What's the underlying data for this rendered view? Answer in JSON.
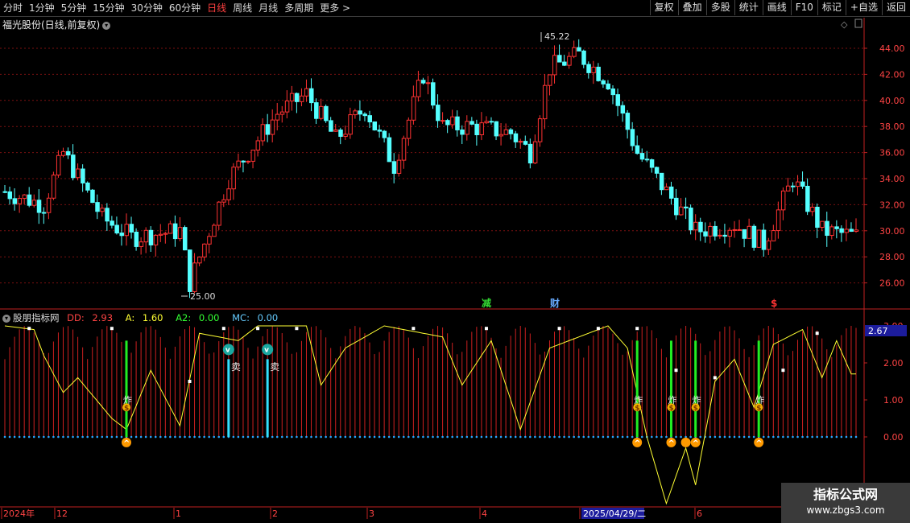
{
  "toolbar": {
    "periods": [
      "分时",
      "1分钟",
      "5分钟",
      "15分钟",
      "30分钟",
      "60分钟",
      "日线",
      "周线",
      "月线",
      "多周期",
      "更多 >"
    ],
    "active_period": "日线",
    "right_buttons": [
      "复权",
      "叠加",
      "多股",
      "统计",
      "画线",
      "F10",
      "标记",
      "+自选",
      "返回"
    ]
  },
  "main_panel": {
    "title": "福光股份(日线,前复权)",
    "high_label": "45.22",
    "low_label": "25.00",
    "price_ticks": [
      "44.00",
      "42.00",
      "40.00",
      "38.00",
      "36.00",
      "34.00",
      "32.00",
      "30.00",
      "28.00",
      "26.00"
    ],
    "markers": [
      {
        "text": "减",
        "color": "#33dd33"
      },
      {
        "text": "财",
        "color": "#66aaff"
      },
      {
        "text": "$",
        "color": "#ff3333"
      }
    ]
  },
  "indicator": {
    "name": "股朋指标网",
    "dd_label": "DD:",
    "dd_value": "2.93",
    "a_label": "A:",
    "a_value": "1.60",
    "a2_label": "A2:",
    "a2_value": "0.00",
    "mc_label": "MC:",
    "mc_value": "0.00",
    "axis_ticks": [
      "2.00",
      "1.00",
      "0.00"
    ],
    "current_value": "2.67",
    "sell_label": "卖",
    "zha_label": "炸"
  },
  "time_axis": {
    "labels": [
      "2024年",
      "12",
      "1",
      "2",
      "3",
      "4",
      "2025/04/29/二",
      "6"
    ]
  },
  "watermark": {
    "line1": "指标公式网",
    "line2": "www.zbgs3.com"
  },
  "colors": {
    "up": "#ff3232",
    "down": "#54ffff",
    "grid": "#7a1010",
    "axis": "#c02020",
    "yellow": "#ffff33",
    "green": "#22ee22"
  }
}
